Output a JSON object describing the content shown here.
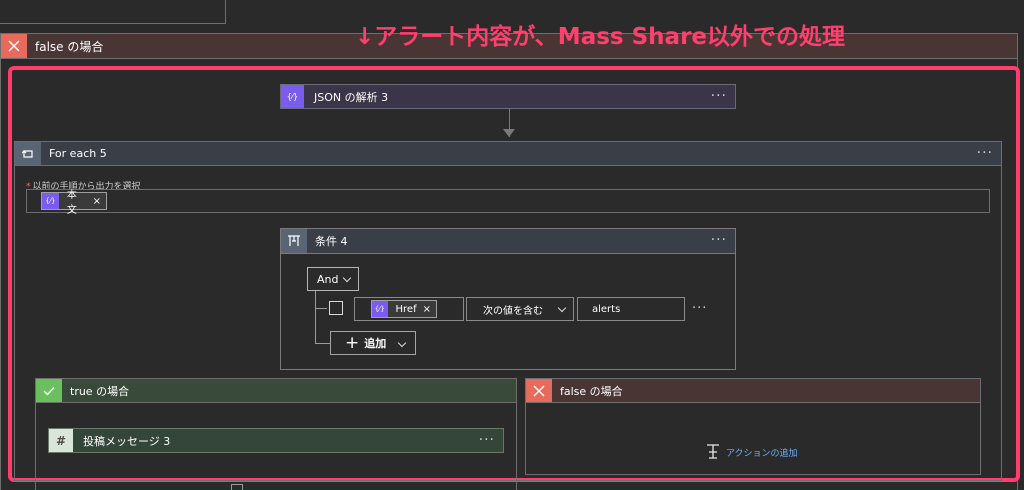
{
  "annotation": "↓アラート内容が、Mass Share以外での処理",
  "outer_false": {
    "label": "false の場合"
  },
  "json_action": {
    "label": "JSON の解析 3",
    "icon": "braces-icon",
    "more": "···"
  },
  "foreach": {
    "label": "For each 5",
    "more": "···",
    "select_label": "以前の手順から出力を選択",
    "required_mark": "*",
    "token": {
      "label": "本文",
      "remove": "×"
    }
  },
  "condition": {
    "label": "条件 4",
    "more": "···",
    "and_label": "And",
    "row": {
      "token": {
        "label": "Href",
        "remove": "×"
      },
      "operator": "次の値を含む",
      "value": "alerts",
      "more": "···"
    },
    "add_label": "追加",
    "add_plus": "+"
  },
  "true_branch": {
    "label": "true の場合",
    "action": {
      "label": "投稿メッセージ 3",
      "more": "···",
      "icon_glyph": "#"
    }
  },
  "false_branch": {
    "label": "false の場合",
    "add_action": "アクションの追加"
  },
  "colors": {
    "annotation": "#ff3f6e",
    "highlight": "#ff3d6e",
    "false_icon": "#e66b5c",
    "true_icon": "#6abf5f",
    "token_icon": "#7a5cf0",
    "link": "#6ab0ff"
  }
}
